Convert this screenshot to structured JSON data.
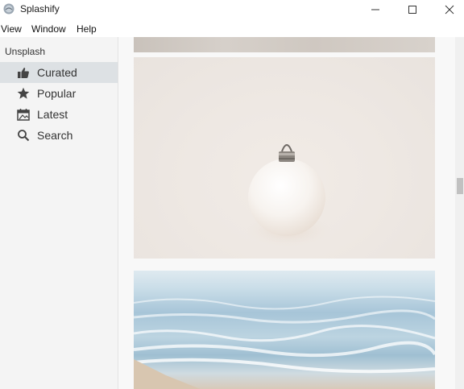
{
  "window": {
    "title": "Splashify",
    "controls": [
      "minimize",
      "maximize",
      "close"
    ]
  },
  "menubar": {
    "items": [
      "View",
      "Window",
      "Help"
    ]
  },
  "sidebar": {
    "header": "Unsplash",
    "items": [
      {
        "label": "Curated",
        "icon": "thumbs-up-icon",
        "active": true
      },
      {
        "label": "Popular",
        "icon": "star-icon",
        "active": false
      },
      {
        "label": "Latest",
        "icon": "calendar-icon",
        "active": false
      },
      {
        "label": "Search",
        "icon": "search-icon",
        "active": false
      }
    ]
  },
  "content": {
    "photos": [
      {
        "subject": "beige surface (partially visible)"
      },
      {
        "subject": "white christmas ornament on cream background"
      },
      {
        "subject": "ocean waves on a beach"
      }
    ]
  },
  "colors": {
    "sidebar_bg": "#f4f4f4",
    "active_item_bg": "#dde1e4",
    "content_bg": "#f8f8f8"
  }
}
